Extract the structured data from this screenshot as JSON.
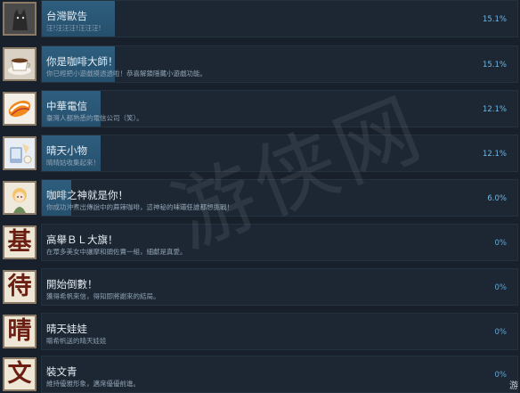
{
  "achievements": [
    {
      "title": "台灣歐告",
      "desc": "汪!汪汪汪!汪汪汪!",
      "percent": "15.1%",
      "progress": 0.151,
      "icon": "gray-cat-icon"
    },
    {
      "title": "你是咖啡大師！",
      "desc": "你已經把小遊戲摸透透啦！恭喜解鎖隱藏小遊戲功能。",
      "percent": "15.1%",
      "progress": 0.151,
      "icon": "coffee-cup-icon"
    },
    {
      "title": "中華電信",
      "desc": "臺灣人都熟悉的電信公司（笑）。",
      "percent": "12.1%",
      "progress": 0.121,
      "icon": "telecom-logo-icon"
    },
    {
      "title": "晴天小物",
      "desc": "晴晴姑收集起來！",
      "percent": "12.1%",
      "progress": 0.121,
      "icon": "phone-charm-icon"
    },
    {
      "title": "咖啡之神就是你！",
      "desc": "你成功沖煮出傳說中的蔴辣咖啡，這神秘的味道任誰都想挑戰！",
      "percent": "6.0%",
      "progress": 0.06,
      "icon": "chibi-girl-icon"
    },
    {
      "title": "高舉ＢＬ大旗！",
      "desc": "在眾多美女中讓摩和頭佐賣一組，細獻是真愛。",
      "percent": "0%",
      "progress": 0,
      "icon": "kanji-ji-icon",
      "kanji": "基"
    },
    {
      "title": "開始倒數！",
      "desc": "獲得希帆來信，得知即將謝來的結局。",
      "percent": "0%",
      "progress": 0,
      "icon": "kanji-dai-icon",
      "kanji": "待"
    },
    {
      "title": "晴天娃娃",
      "desc": "贈希帆送的晴天娃娃",
      "percent": "0%",
      "progress": 0,
      "icon": "kanji-qing-icon",
      "kanji": "晴"
    },
    {
      "title": "裝文青",
      "desc": "維持優雅形象，邁席優優前進。",
      "percent": "0%",
      "progress": 0,
      "icon": "kanji-wen-icon",
      "kanji": "文"
    }
  ],
  "watermark": "游侠网",
  "corner_text": "游"
}
